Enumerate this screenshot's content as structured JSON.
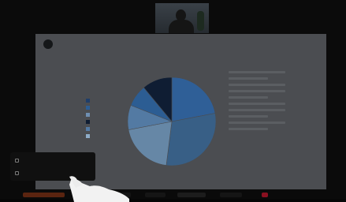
{
  "slide": {
    "title": "",
    "legend": [
      {
        "label": "",
        "color": "#1f3e6a"
      },
      {
        "label": "",
        "color": "#2c5d93"
      },
      {
        "label": "",
        "color": "#6f8fb2"
      },
      {
        "label": "",
        "color": "#0f1d33"
      },
      {
        "label": "",
        "color": "#537aa3"
      },
      {
        "label": "",
        "color": "#8eacc8"
      }
    ],
    "pie_slices": [
      {
        "value": 22,
        "color": "#2f5f97",
        "label": "",
        "text_color": "#a8c4e3"
      },
      {
        "value": 30,
        "color": "#385f86",
        "label": "",
        "text_color": "#a8c4e3"
      },
      {
        "value": 20,
        "color": "#6687a6",
        "label": "",
        "text_color": "#d0d8e2"
      },
      {
        "value": 9,
        "color": "#537aa3",
        "label": "",
        "text_color": "#c5d3e1"
      },
      {
        "value": 8,
        "color": "#2c5d93",
        "label": "",
        "text_color": "#c5d3e1"
      },
      {
        "value": 11,
        "color": "#0f1d33",
        "label": "",
        "text_color": "#9aa7b8"
      }
    ]
  },
  "popup": {
    "items": [
      {
        "label": ""
      },
      {
        "label": ""
      }
    ]
  },
  "controls": {
    "accent": "#7a2f13",
    "record_color": "#8a1020"
  }
}
